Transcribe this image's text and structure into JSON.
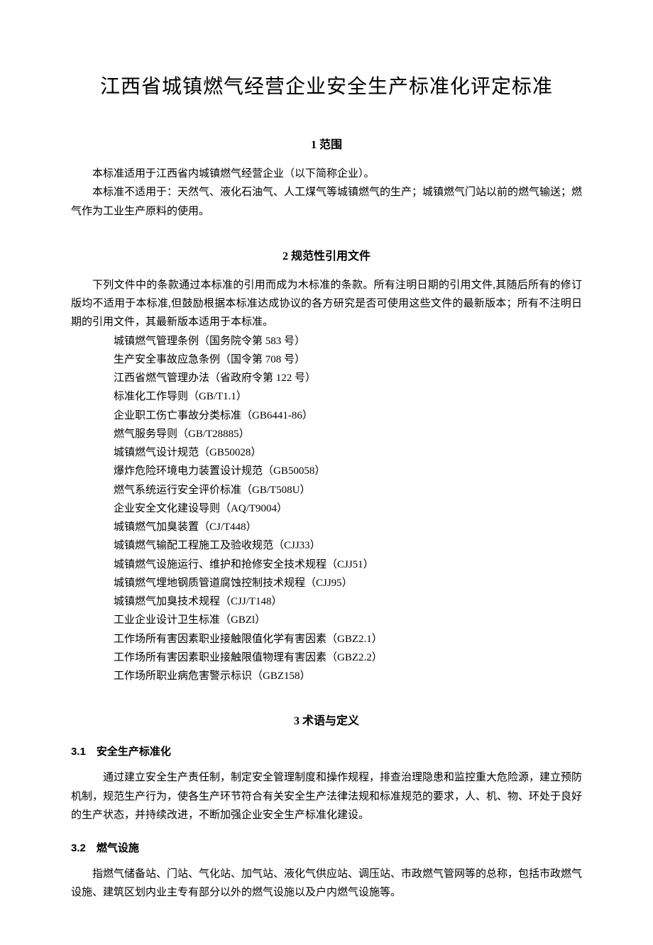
{
  "title": "江西省城镇燃气经营企业安全生产标准化评定标准",
  "sections": {
    "s1": {
      "heading": "1 范围",
      "p1": "本标准适用于江西省内城镇燃气经营企业（以下简称企业）。",
      "p2": "本标准不适用于：天然气、液化石油气、人工煤气等城镇燃气的生产；城镇燃气门站以前的燃气输送；燃气作为工业生产原料的使用。"
    },
    "s2": {
      "heading": "2 规范性引用文件",
      "intro": "下列文件中的条款通过本标准的引用而成为木标准的条款。所有注明日期的引用文件,其随后所有的修订版均不适用于本标准,但鼓励根据本标准达成协议的各方研究是否可使用这些文件的最新版本；所有不注明日期的引用文件，其最新版本适用于本标准。",
      "refs": [
        "城镇燃气管理条例（国务院令第 583 号）",
        "生产安全事故应急条例（国令第 708 号）",
        "江西省燃气管理办法（省政府令第 122 号）",
        "标准化工作导则（GB/T1.1）",
        "企业职工伤亡事故分类标准（GB6441-86）",
        "燃气服务导则（GB/T28885）",
        "城镇燃气设计规范（GB50028）",
        "爆炸危险环境电力装置设计规范（GB50058）",
        "燃气系统运行安全评价标准（GB/T508U）",
        "企业安全文化建设导则（AQ/T9004）",
        "城镇燃气加臭装置（CJ/T448）",
        "城镇燃气输配工程施工及验收规范（CJJ33）",
        "城镇燃气设施运行、维护和抢修安全技术规程（CJJ51）",
        "城镇燃气埋地钢质管道腐蚀控制技术规程（CJJ95）",
        "城镇燃气加臭技术规程（CJJ/T148）",
        "工业企业设计卫生标准（GBZl）",
        "工作场所有害因素职业接触限值化学有害因素（GBZ2.1）",
        "工作场所有害因素职业接触限值物理有害因素（GBZ2.2）",
        "工作场所职业病危害警示标识（GBZ158）"
      ]
    },
    "s3": {
      "heading": "3 术语与定义",
      "sub1": {
        "heading": "3.1　安全生产标准化",
        "body": "通过建立安全生产责任制，制定安全管理制度和操作规程，排查治理隐患和监控重大危险源，建立预防机制，规范生产行为，使各生产环节符合有关安全生产法律法规和标准规范的要求，人、机、物、环处于良好的生产状态，并持续改进，不断加强企业安全生产标准化建设。"
      },
      "sub2": {
        "heading": "3.2　燃气设施",
        "body": "指燃气储备站、门站、气化站、加气站、液化气供应站、调压站、市政燃气管网等的总称，包括市政燃气设施、建筑区划内业主专有部分以外的燃气设施以及户内燃气设施等。"
      }
    }
  }
}
